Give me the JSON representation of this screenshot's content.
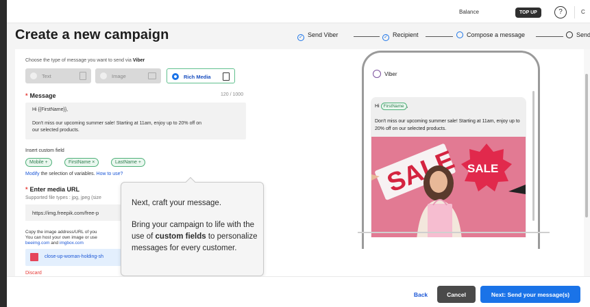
{
  "topbar": {
    "balance_label": "Balance",
    "topup_label": "TOP UP",
    "help_icon": "?",
    "truncated_text": "C"
  },
  "header": {
    "title": "Create a new campaign",
    "steps": [
      {
        "label": "Send Viber",
        "state": "done"
      },
      {
        "label": "Recipient",
        "state": "done"
      },
      {
        "label": "Compose a message",
        "state": "current"
      },
      {
        "label": "Send",
        "state": "pending"
      }
    ]
  },
  "form": {
    "type_label_prefix": "Choose the type of message you want to send via ",
    "type_label_brand": "Viber",
    "types": [
      {
        "label": "Text",
        "icon": "document-icon",
        "selected": false
      },
      {
        "label": "Image",
        "icon": "image-icon",
        "selected": false
      },
      {
        "label": "Rich Media",
        "icon": "rich-media-icon",
        "selected": true
      }
    ],
    "message_label": "Message",
    "message_count": "120 / 1000",
    "message_lines": [
      "Hi {{FirstName}},",
      "Don't miss our upcoming summer sale! Starting at 11am, enjoy up to 20% off on",
      "our selected products."
    ],
    "insert_label": "Insert custom field",
    "fields": [
      {
        "label": "Mobile",
        "action": "+"
      },
      {
        "label": "FirstName",
        "action": "×"
      },
      {
        "label": "LastName",
        "action": "+"
      }
    ],
    "modify_link": "Modify",
    "modify_text": " the selection of variables. ",
    "how_link": "How to use?",
    "media_label": "Enter media URL",
    "file_types": "Supported file types : jpg, jpeg (size",
    "media_url": "https://img.freepik.com/free-p",
    "copy_line1": "Copy the image address/URL of you",
    "copy_line2": "You can host your own image or use",
    "copy_link1": "beeimg.com",
    "copy_and": " and ",
    "copy_link2": "imgbox.com",
    "file_name": "close-up-woman-holding-sh",
    "discard": "Discard"
  },
  "preview": {
    "app_label": "Viber",
    "greeting": "Hi ",
    "name_chip": "FirstName",
    "comma": ",",
    "body": "Don't miss our upcoming summer sale! Starting at 11am, enjoy up to 20% off on our selected products.",
    "image_text_1": "SALE",
    "image_text_2": "SALE"
  },
  "tooltip": {
    "p1": "Next, craft your message.",
    "p2_before": "Bring your campaign to life with the use of ",
    "p2_bold": "custom fields",
    "p2_after": " to personalize messages for every customer."
  },
  "footer": {
    "back": "Back",
    "cancel": "Cancel",
    "next": "Next: Send your message(s)"
  },
  "colors": {
    "primary": "#1a73e8",
    "chip_green": "#4caf77",
    "required": "#e53935",
    "cancel_bg": "#4a4a4a"
  }
}
